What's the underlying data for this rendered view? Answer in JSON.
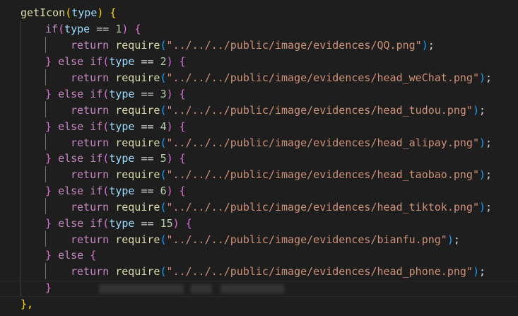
{
  "code": {
    "fn_name": "getIcon",
    "param": "type",
    "kw_if": "if",
    "kw_else": "else",
    "kw_return": "return",
    "fn_require": "require",
    "op_eq": "==",
    "closing": "},",
    "branches": [
      {
        "num": "1",
        "path": "\"../../../public/image/evidences/QQ.png\""
      },
      {
        "num": "2",
        "path": "\"../../../public/image/evidences/head_weChat.png\""
      },
      {
        "num": "3",
        "path": "\"../../../public/image/evidences/head_tudou.png\""
      },
      {
        "num": "4",
        "path": "\"../../../public/image/evidences/head_alipay.png\""
      },
      {
        "num": "5",
        "path": "\"../../../public/image/evidences/head_taobao.png\""
      },
      {
        "num": "6",
        "path": "\"../../../public/image/evidences/head_tiktok.png\""
      },
      {
        "num": "15",
        "path": "\"../../../public/image/evidences/bianfu.png\""
      }
    ],
    "else_path": "\"../../../public/image/evidences/head_phone.png\""
  },
  "colors": {
    "background": "#1e1e1e",
    "function": "#dcdcaa",
    "keyword": "#c586c0",
    "variable": "#9cdcfe",
    "number": "#b5cea8",
    "string": "#ce9178",
    "bracket_level1": "#ffd700",
    "bracket_level2": "#da70d6",
    "bracket_level3": "#179fff"
  }
}
